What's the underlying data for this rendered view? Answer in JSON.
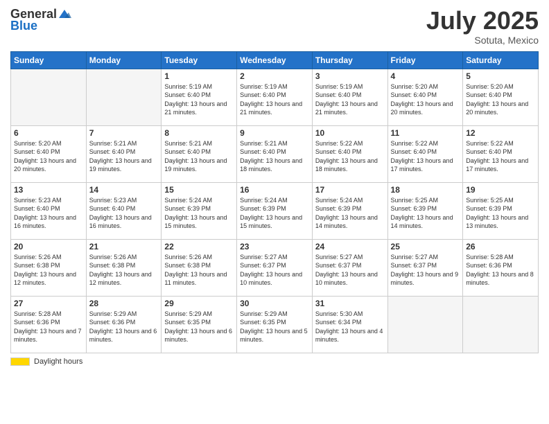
{
  "header": {
    "logo_general": "General",
    "logo_blue": "Blue",
    "month_title": "July 2025",
    "subtitle": "Sotuta, Mexico"
  },
  "footer": {
    "daylight_label": "Daylight hours"
  },
  "weekdays": [
    "Sunday",
    "Monday",
    "Tuesday",
    "Wednesday",
    "Thursday",
    "Friday",
    "Saturday"
  ],
  "weeks": [
    [
      {
        "day": "",
        "info": ""
      },
      {
        "day": "",
        "info": ""
      },
      {
        "day": "1",
        "info": "Sunrise: 5:19 AM\nSunset: 6:40 PM\nDaylight: 13 hours and 21 minutes."
      },
      {
        "day": "2",
        "info": "Sunrise: 5:19 AM\nSunset: 6:40 PM\nDaylight: 13 hours and 21 minutes."
      },
      {
        "day": "3",
        "info": "Sunrise: 5:19 AM\nSunset: 6:40 PM\nDaylight: 13 hours and 21 minutes."
      },
      {
        "day": "4",
        "info": "Sunrise: 5:20 AM\nSunset: 6:40 PM\nDaylight: 13 hours and 20 minutes."
      },
      {
        "day": "5",
        "info": "Sunrise: 5:20 AM\nSunset: 6:40 PM\nDaylight: 13 hours and 20 minutes."
      }
    ],
    [
      {
        "day": "6",
        "info": "Sunrise: 5:20 AM\nSunset: 6:40 PM\nDaylight: 13 hours and 20 minutes."
      },
      {
        "day": "7",
        "info": "Sunrise: 5:21 AM\nSunset: 6:40 PM\nDaylight: 13 hours and 19 minutes."
      },
      {
        "day": "8",
        "info": "Sunrise: 5:21 AM\nSunset: 6:40 PM\nDaylight: 13 hours and 19 minutes."
      },
      {
        "day": "9",
        "info": "Sunrise: 5:21 AM\nSunset: 6:40 PM\nDaylight: 13 hours and 18 minutes."
      },
      {
        "day": "10",
        "info": "Sunrise: 5:22 AM\nSunset: 6:40 PM\nDaylight: 13 hours and 18 minutes."
      },
      {
        "day": "11",
        "info": "Sunrise: 5:22 AM\nSunset: 6:40 PM\nDaylight: 13 hours and 17 minutes."
      },
      {
        "day": "12",
        "info": "Sunrise: 5:22 AM\nSunset: 6:40 PM\nDaylight: 13 hours and 17 minutes."
      }
    ],
    [
      {
        "day": "13",
        "info": "Sunrise: 5:23 AM\nSunset: 6:40 PM\nDaylight: 13 hours and 16 minutes."
      },
      {
        "day": "14",
        "info": "Sunrise: 5:23 AM\nSunset: 6:40 PM\nDaylight: 13 hours and 16 minutes."
      },
      {
        "day": "15",
        "info": "Sunrise: 5:24 AM\nSunset: 6:39 PM\nDaylight: 13 hours and 15 minutes."
      },
      {
        "day": "16",
        "info": "Sunrise: 5:24 AM\nSunset: 6:39 PM\nDaylight: 13 hours and 15 minutes."
      },
      {
        "day": "17",
        "info": "Sunrise: 5:24 AM\nSunset: 6:39 PM\nDaylight: 13 hours and 14 minutes."
      },
      {
        "day": "18",
        "info": "Sunrise: 5:25 AM\nSunset: 6:39 PM\nDaylight: 13 hours and 14 minutes."
      },
      {
        "day": "19",
        "info": "Sunrise: 5:25 AM\nSunset: 6:39 PM\nDaylight: 13 hours and 13 minutes."
      }
    ],
    [
      {
        "day": "20",
        "info": "Sunrise: 5:26 AM\nSunset: 6:38 PM\nDaylight: 13 hours and 12 minutes."
      },
      {
        "day": "21",
        "info": "Sunrise: 5:26 AM\nSunset: 6:38 PM\nDaylight: 13 hours and 12 minutes."
      },
      {
        "day": "22",
        "info": "Sunrise: 5:26 AM\nSunset: 6:38 PM\nDaylight: 13 hours and 11 minutes."
      },
      {
        "day": "23",
        "info": "Sunrise: 5:27 AM\nSunset: 6:37 PM\nDaylight: 13 hours and 10 minutes."
      },
      {
        "day": "24",
        "info": "Sunrise: 5:27 AM\nSunset: 6:37 PM\nDaylight: 13 hours and 10 minutes."
      },
      {
        "day": "25",
        "info": "Sunrise: 5:27 AM\nSunset: 6:37 PM\nDaylight: 13 hours and 9 minutes."
      },
      {
        "day": "26",
        "info": "Sunrise: 5:28 AM\nSunset: 6:36 PM\nDaylight: 13 hours and 8 minutes."
      }
    ],
    [
      {
        "day": "27",
        "info": "Sunrise: 5:28 AM\nSunset: 6:36 PM\nDaylight: 13 hours and 7 minutes."
      },
      {
        "day": "28",
        "info": "Sunrise: 5:29 AM\nSunset: 6:36 PM\nDaylight: 13 hours and 6 minutes."
      },
      {
        "day": "29",
        "info": "Sunrise: 5:29 AM\nSunset: 6:35 PM\nDaylight: 13 hours and 6 minutes."
      },
      {
        "day": "30",
        "info": "Sunrise: 5:29 AM\nSunset: 6:35 PM\nDaylight: 13 hours and 5 minutes."
      },
      {
        "day": "31",
        "info": "Sunrise: 5:30 AM\nSunset: 6:34 PM\nDaylight: 13 hours and 4 minutes."
      },
      {
        "day": "",
        "info": ""
      },
      {
        "day": "",
        "info": ""
      }
    ]
  ]
}
